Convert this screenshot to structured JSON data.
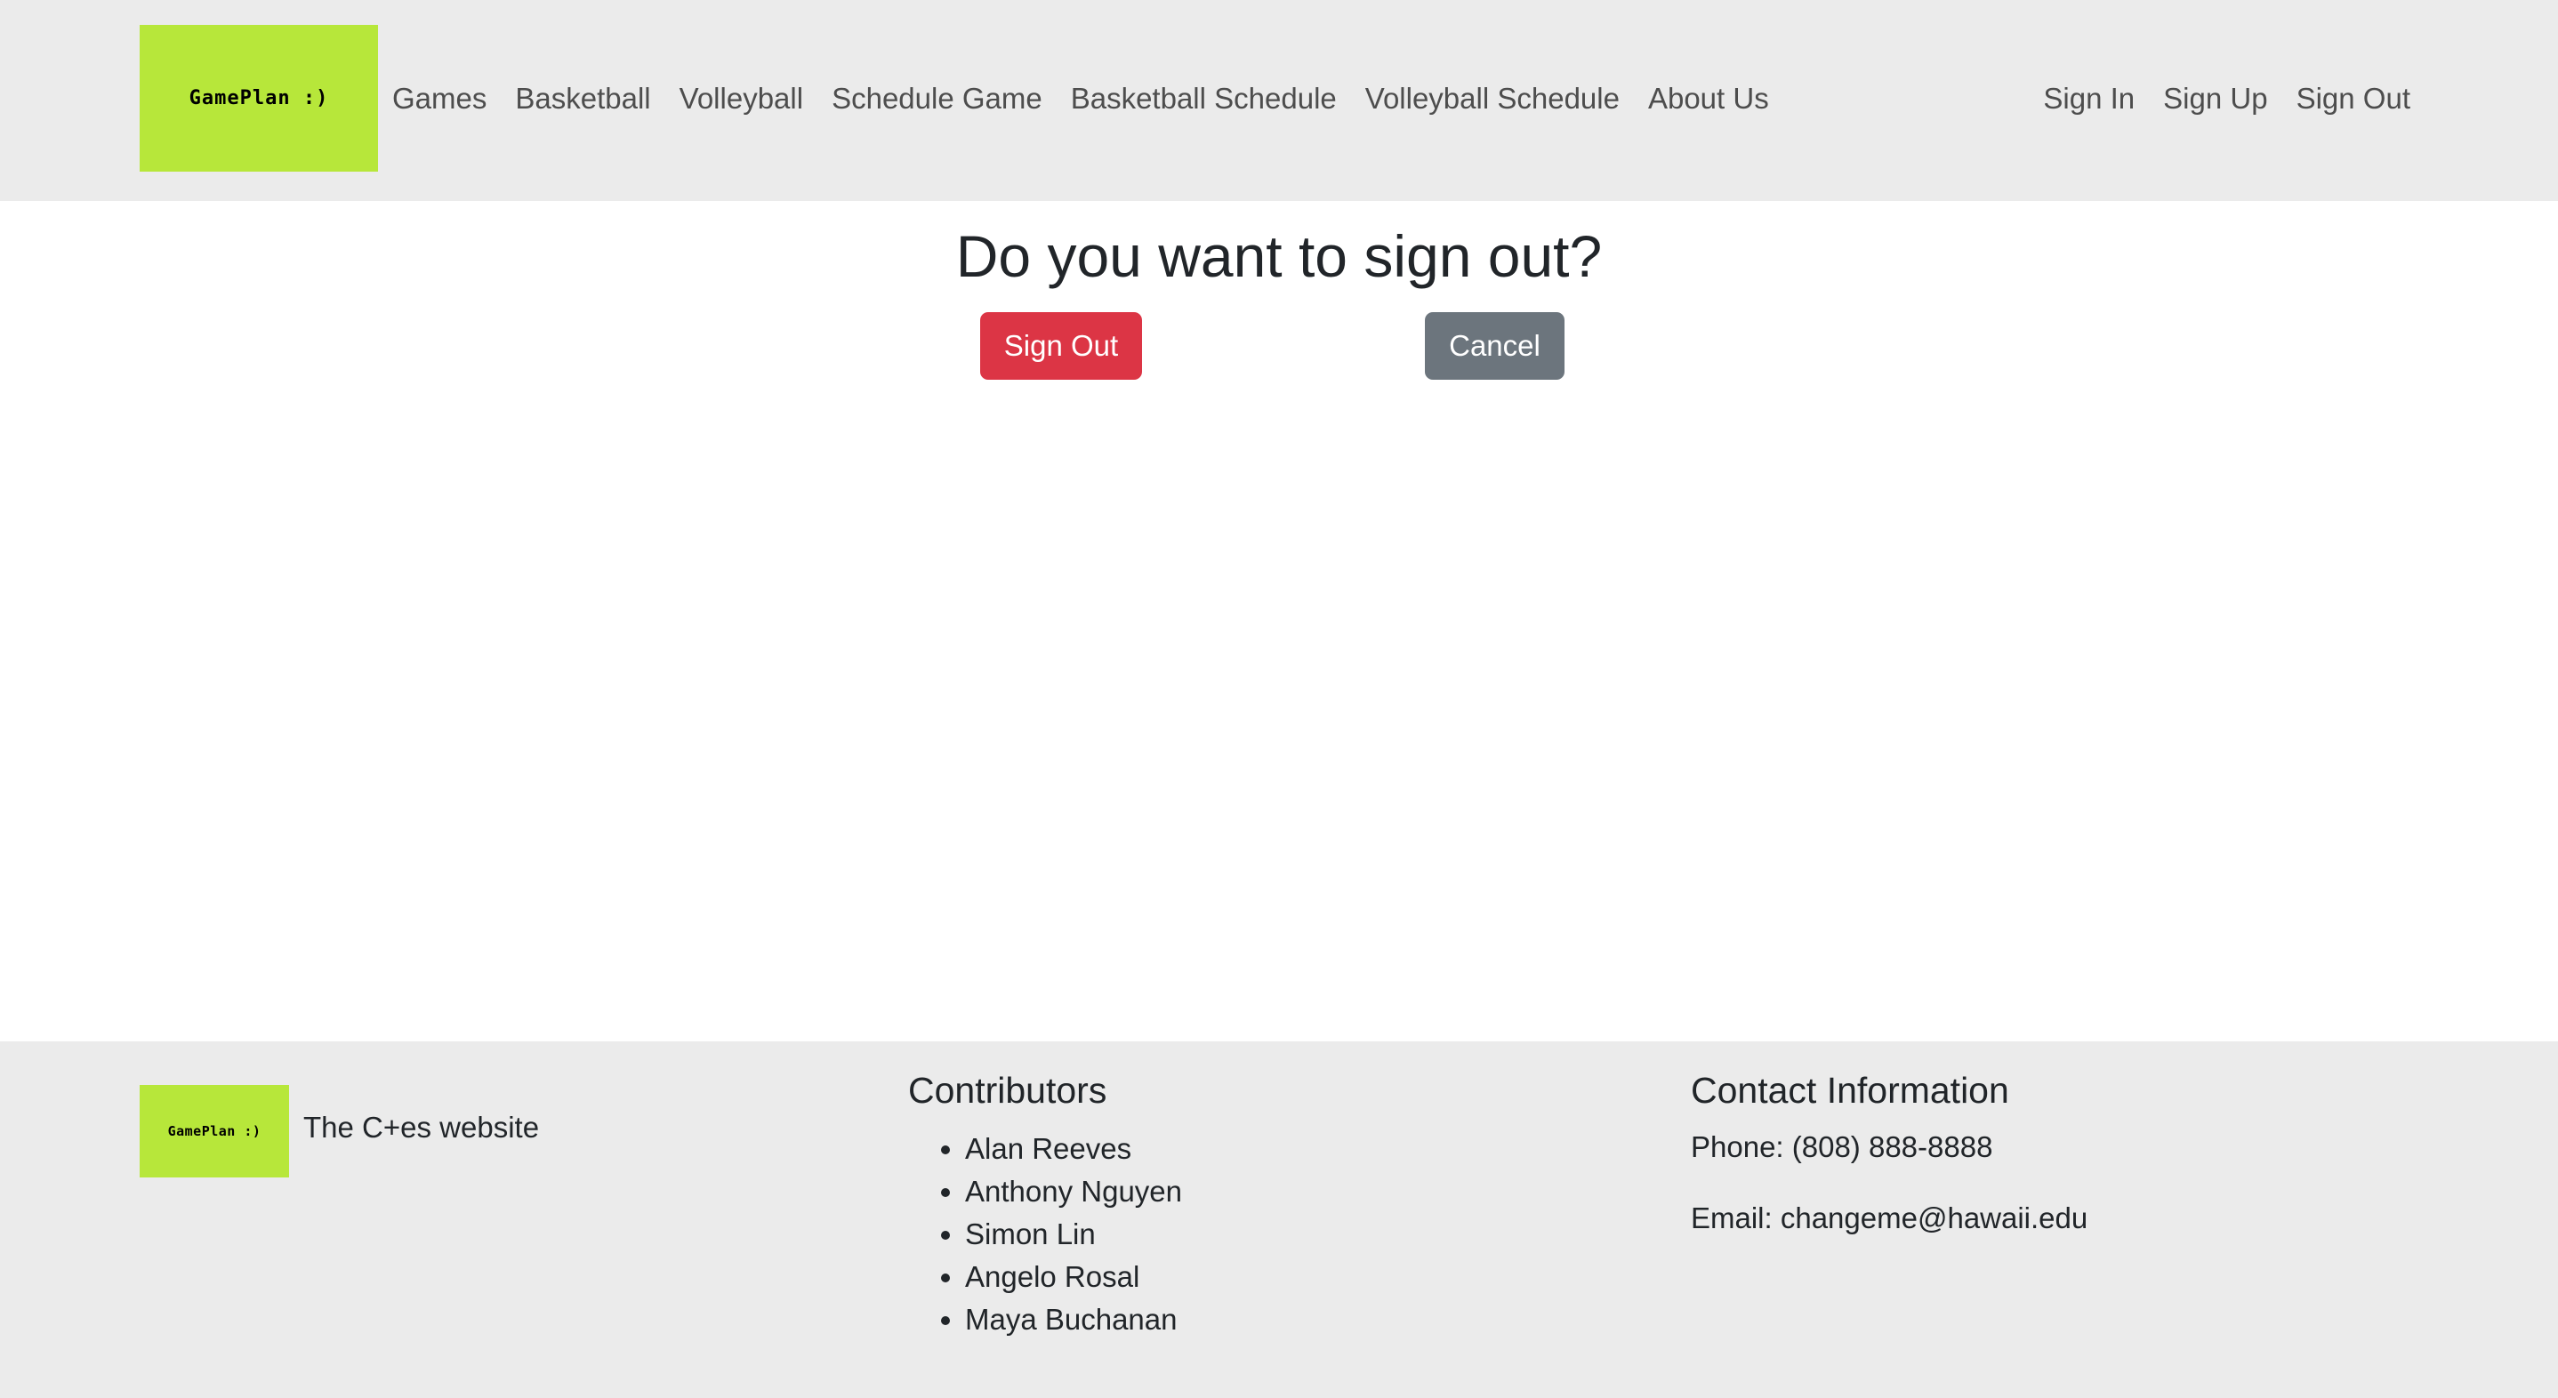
{
  "brand": {
    "logo_text": "GamePlan :)"
  },
  "nav": {
    "left": [
      {
        "label": "Games"
      },
      {
        "label": "Basketball"
      },
      {
        "label": "Volleyball"
      },
      {
        "label": "Schedule Game"
      },
      {
        "label": "Basketball Schedule"
      },
      {
        "label": "Volleyball Schedule"
      },
      {
        "label": "About Us"
      }
    ],
    "right": [
      {
        "label": "Sign In"
      },
      {
        "label": "Sign Up"
      },
      {
        "label": "Sign Out"
      }
    ]
  },
  "main": {
    "title": "Do you want to sign out?",
    "signout_label": "Sign Out",
    "cancel_label": "Cancel"
  },
  "footer": {
    "logo_text": "GamePlan :)",
    "tagline": "The C+es website",
    "contributors_title": "Contributors",
    "contributors": [
      "Alan Reeves",
      "Anthony Nguyen",
      "Simon Lin",
      "Angelo Rosal",
      "Maya Buchanan"
    ],
    "contact_title": "Contact Information",
    "phone": "Phone: (808) 888-8888",
    "email": "Email: changeme@hawaii.edu"
  },
  "colors": {
    "logo_bg": "#b7e73a",
    "bar_bg": "#ebebeb",
    "danger": "#dc3545",
    "secondary": "#6c757d"
  }
}
